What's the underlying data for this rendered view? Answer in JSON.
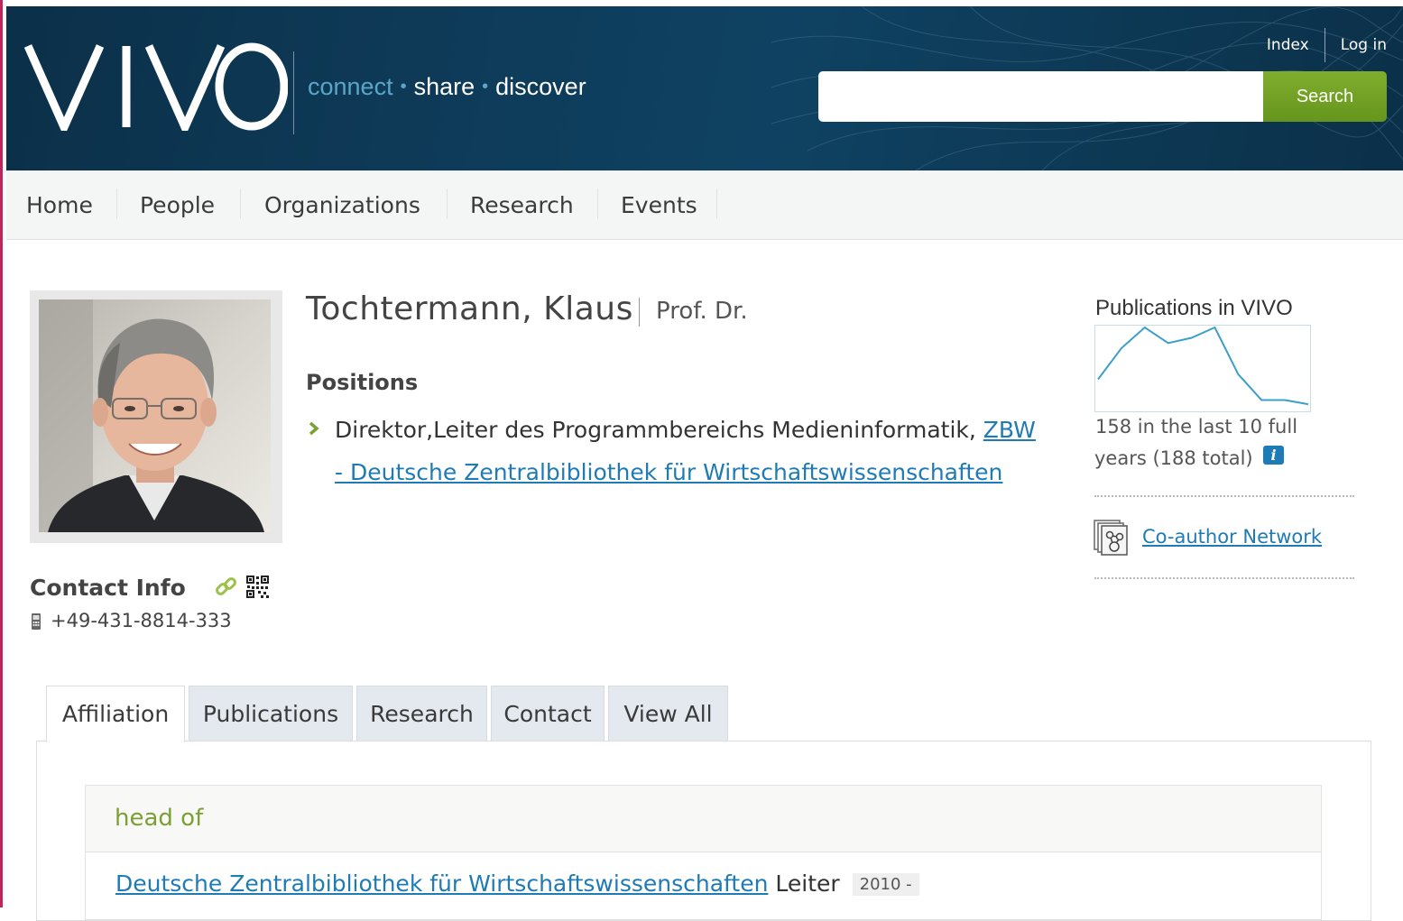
{
  "header": {
    "logo_text": "VIVO",
    "tagline": {
      "connect": "connect",
      "dot": "•",
      "share": "share",
      "discover": "discover"
    },
    "links": {
      "index": "Index",
      "login": "Log in"
    },
    "search": {
      "value": "",
      "placeholder": "",
      "button": "Search"
    }
  },
  "nav": {
    "items": [
      "Home",
      "People",
      "Organizations",
      "Research",
      "Events"
    ]
  },
  "profile": {
    "name": "Tochtermann, Klaus",
    "title": "Prof. Dr.",
    "positions_heading": "Positions",
    "position": {
      "text": "Direktor,Leiter des Programmbereichs Medieninformatik,",
      "org_part1": "ZBW",
      "org_part2": "- Deutsche Zentralbibliothek für Wirtschaftswissenschaften"
    },
    "contact_heading": "Contact Info",
    "phone": "+49-431-8814-333"
  },
  "sidebar": {
    "pub_heading": "Publications in VIVO",
    "count_line1": "158 in the last 10 full",
    "count_line2": "years (188 total)",
    "info_glyph": "i",
    "coauthor_link": "Co-author Network"
  },
  "chart_data": {
    "type": "line",
    "title": "",
    "values": [
      3,
      6,
      8,
      6.5,
      7,
      8,
      3.5,
      1,
      1,
      0.6
    ],
    "xlabel": "",
    "ylabel": ""
  },
  "tabs": [
    "Affiliation",
    "Publications",
    "Research",
    "Contact",
    "View All"
  ],
  "affiliation": {
    "group_title": "head of",
    "item": {
      "org": "Deutsche Zentralbibliothek für Wirtschaftswissenschaften",
      "role": "Leiter",
      "date": "2010 -"
    }
  },
  "colors": {
    "header_bg": "#0b3049",
    "accent_blue": "#5aa6c8",
    "search_green": "#72a326",
    "link_blue": "#1f7bb5",
    "group_title_green": "#7ba034",
    "left_edge": "#c0245a"
  },
  "icons": {
    "link": "link-icon",
    "qr": "qr-code-icon",
    "phone": "phone-icon",
    "info": "info-icon",
    "network": "coauthor-network-icon",
    "arrow": "chevron-right-icon"
  }
}
